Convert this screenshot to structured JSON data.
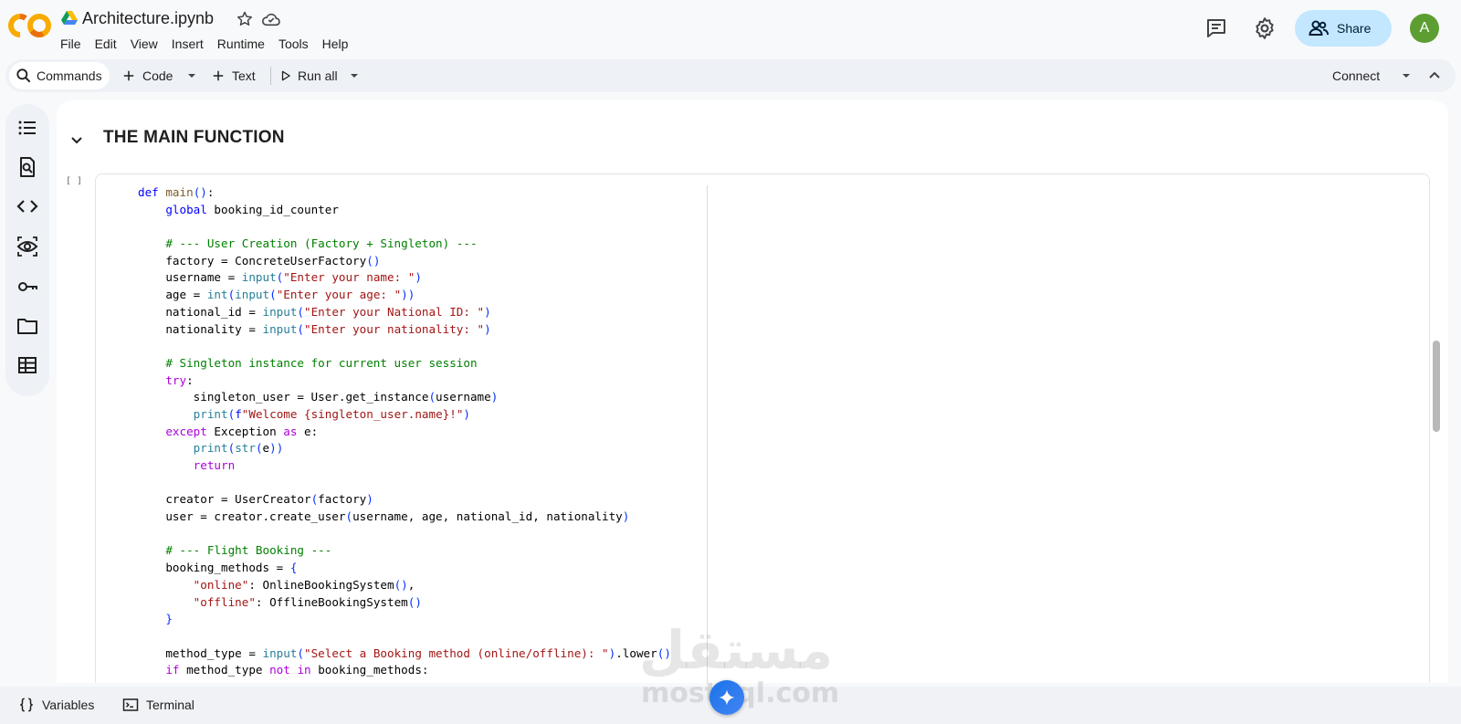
{
  "header": {
    "title": "Architecture.ipynb",
    "menu": [
      "File",
      "Edit",
      "View",
      "Insert",
      "Runtime",
      "Tools",
      "Help"
    ],
    "share_label": "Share",
    "avatar_initial": "A"
  },
  "toolbar": {
    "commands_label": "Commands",
    "code_label": "Code",
    "text_label": "Text",
    "run_all_label": "Run all",
    "connect_label": "Connect"
  },
  "notebook": {
    "section_title": "THE MAIN FUNCTION",
    "cell_run_marker": "[ ]",
    "code_lines": [
      "def main():",
      "    global booking_id_counter",
      "",
      "    # --- User Creation (Factory + Singleton) ---",
      "    factory = ConcreteUserFactory()",
      "    username = input(\"Enter your name: \")",
      "    age = int(input(\"Enter your age: \"))",
      "    national_id = input(\"Enter your National ID: \")",
      "    nationality = input(\"Enter your nationality: \")",
      "",
      "    # Singleton instance for current user session",
      "    try:",
      "        singleton_user = User.get_instance(username)",
      "        print(f\"Welcome {singleton_user.name}!\")",
      "    except Exception as e:",
      "        print(str(e))",
      "        return",
      "",
      "    creator = UserCreator(factory)",
      "    user = creator.create_user(username, age, national_id, nationality)",
      "",
      "    # --- Flight Booking ---",
      "    booking_methods = {",
      "        \"online\": OnlineBookingSystem(),",
      "        \"offline\": OfflineBookingSystem()",
      "    }",
      "",
      "    method_type = input(\"Select a Booking method (online/offline): \").lower()",
      "    if method_type not in booking_methods:"
    ]
  },
  "bottom_bar": {
    "variables_label": "Variables",
    "terminal_label": "Terminal"
  },
  "watermark": {
    "arabic": "مستقل",
    "latin": "mostaql.com"
  },
  "colors": {
    "share_bg": "#c2e7ff",
    "avatar_bg": "#5c9e31",
    "keyword": "#af00db",
    "string": "#a31515",
    "comment": "#008000",
    "function": "#795e26"
  }
}
